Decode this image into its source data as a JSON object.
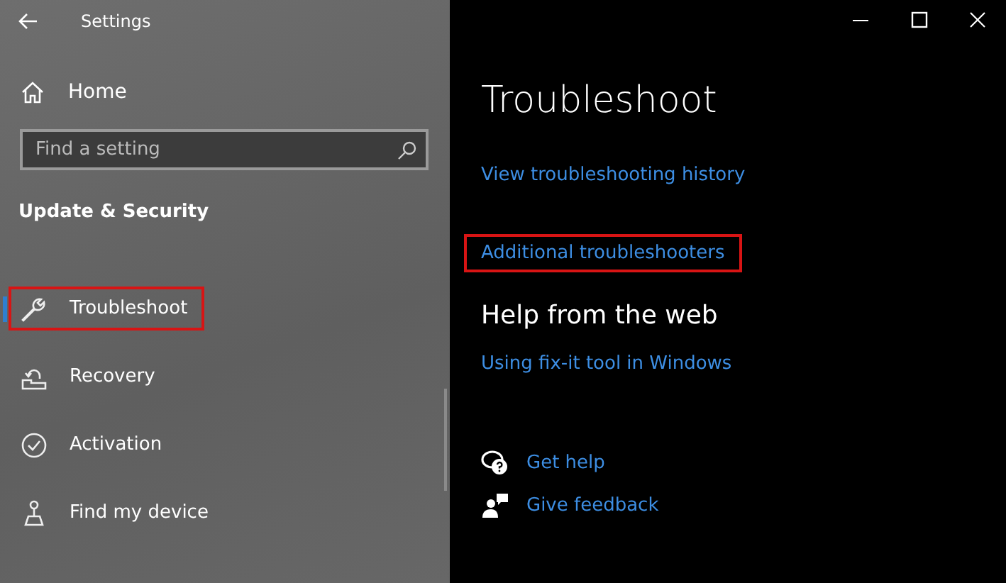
{
  "window": {
    "title": "Settings"
  },
  "sidebar": {
    "home": "Home",
    "search": {
      "placeholder": "Find a setting"
    },
    "section": "Update & Security",
    "items": [
      {
        "label": "Troubleshoot",
        "selected": true,
        "highlighted": true
      },
      {
        "label": "Recovery",
        "selected": false,
        "highlighted": false
      },
      {
        "label": "Activation",
        "selected": false,
        "highlighted": false
      },
      {
        "label": "Find my device",
        "selected": false,
        "highlighted": false
      }
    ]
  },
  "content": {
    "title": "Troubleshoot",
    "links": [
      {
        "label": "View troubleshooting history",
        "highlighted": false
      },
      {
        "label": "Additional troubleshooters",
        "highlighted": true
      }
    ],
    "web_heading": "Help from the web",
    "web_links": [
      "Using fix-it tool in Windows"
    ],
    "help_links": [
      {
        "label": "Get help"
      },
      {
        "label": "Give feedback"
      }
    ]
  }
}
